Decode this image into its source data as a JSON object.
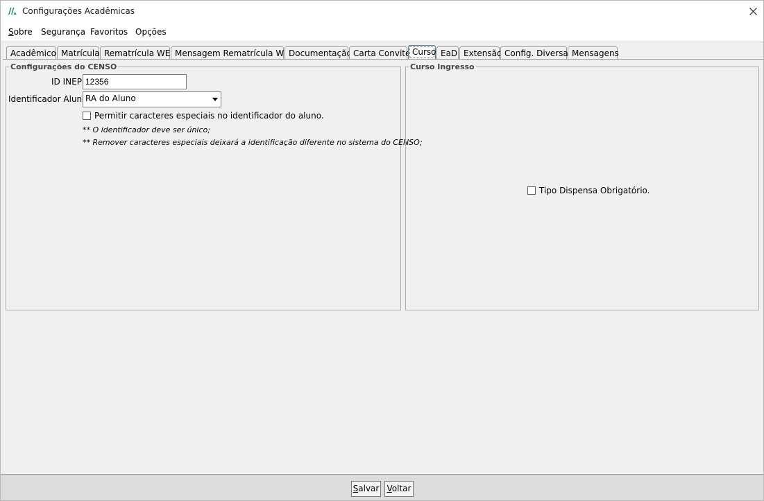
{
  "window": {
    "title": "Configurações Acadêmicas"
  },
  "menu": {
    "items": [
      {
        "mnemonic": "S",
        "rest": "obre"
      },
      {
        "mnemonic": "",
        "rest": "Segurança"
      },
      {
        "mnemonic": "",
        "rest": "Favoritos"
      },
      {
        "mnemonic": "",
        "rest": "Opções"
      }
    ]
  },
  "tabs": [
    "Acadêmico",
    "Matrícula",
    "Rematrícula WEB",
    "Mensagem Rematrícula WEB",
    "Documentação",
    "Carta Convite",
    "Curso",
    "EaD",
    "Extensão",
    "Config. Diversas",
    "Mensagens"
  ],
  "active_tab": "Curso",
  "censo": {
    "legend": "Configurações do CENSO",
    "id_inep_label": "ID INEP:",
    "id_inep_value": "12356",
    "identificador_label": "Identificador Aluno:",
    "identificador_value": "RA do Aluno",
    "permitir_label": "Permitir caracteres especiais no identificador do aluno.",
    "permitir_checked": false,
    "note1": "** O identificador deve ser único;",
    "note2": "** Remover caracteres especiais deixará a identificação diferente no sistema do CENSO;"
  },
  "curso_ingresso": {
    "legend": "Curso Ingresso",
    "tipo_dispensa_label": "Tipo Dispensa Obrigatório.",
    "tipo_dispensa_checked": false
  },
  "footer": {
    "salvar_mnemonic": "S",
    "salvar_rest": "alvar",
    "voltar_mnemonic": "V",
    "voltar_rest": "oltar"
  },
  "colors": {
    "accent": "#1a8a7a",
    "tab_active_border": "#5a7aa6"
  }
}
